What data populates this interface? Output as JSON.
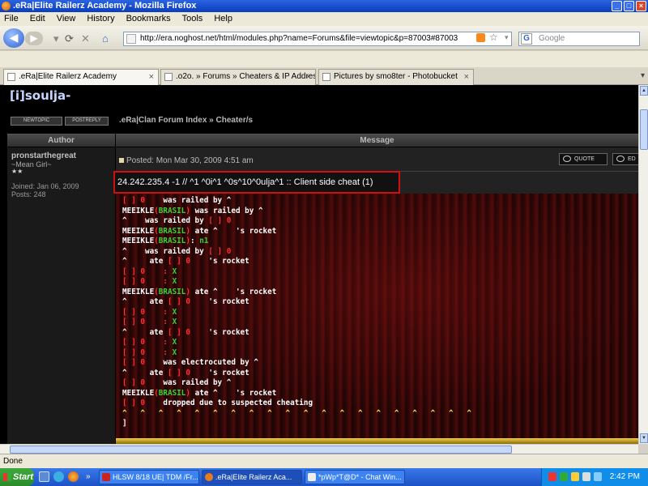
{
  "window": {
    "title": ".eRa|Elite Railerz Academy - Mozilla Firefox"
  },
  "menu": [
    "File",
    "Edit",
    "View",
    "History",
    "Bookmarks",
    "Tools",
    "Help"
  ],
  "nav": {
    "url": "http://era.noghost.net/html/modules.php?name=Forums&file=viewtopic&p=87003#87003",
    "search_placeholder": "Google"
  },
  "tabs": [
    {
      "label": ".eRa|Elite Railerz Academy",
      "active": true
    },
    {
      "label": ".o2o. » Forums » Cheaters & IP Addres...",
      "active": false
    },
    {
      "label": "Pictures by smo8ter - Photobucket",
      "active": false
    }
  ],
  "page": {
    "site_title": "[i]soulja-",
    "newtopic": "NEWTOPIC",
    "postreply": "POSTREPLY",
    "breadcrumb": ".eRa|Clan Forum Index » Cheater/s",
    "col_author": "Author",
    "col_message": "Message"
  },
  "post": {
    "author": "pronstarthegreat",
    "author_title": "~Mean Girl~",
    "rank": "★★",
    "joined": "Joined: Jan 06, 2009",
    "posts": "Posts: 248",
    "posted": "Posted: Mon Mar 30, 2009 4:51 am",
    "quote_btn": "QUOTE",
    "edit_btn": "ED",
    "headline": "24.242.235.4 -1 // ^1 ^0i^1 ^0s^10^0ulja^1 :: Client side cheat (1)"
  },
  "console_lines": [
    [
      {
        "t": "[ ] 0 ",
        "c": "r"
      },
      {
        "t": "   was railed by ^",
        "c": "w"
      }
    ],
    [
      {
        "t": "MEEIKLE",
        "c": "w"
      },
      {
        "t": "(",
        "c": "r"
      },
      {
        "t": "BRASIL",
        "c": "g"
      },
      {
        "t": ")",
        "c": "r"
      },
      {
        "t": " was railed by ^",
        "c": "w"
      }
    ],
    [
      {
        "t": "^    was railed by ",
        "c": "w"
      },
      {
        "t": "[ ] 0",
        "c": "r"
      }
    ],
    [
      {
        "t": "MEEIKLE",
        "c": "w"
      },
      {
        "t": "(",
        "c": "r"
      },
      {
        "t": "BRASIL",
        "c": "g"
      },
      {
        "t": ")",
        "c": "r"
      },
      {
        "t": " ate ^    's rocket",
        "c": "w"
      }
    ],
    [
      {
        "t": "MEEIKLE",
        "c": "w"
      },
      {
        "t": "(",
        "c": "r"
      },
      {
        "t": "BRASIL",
        "c": "g"
      },
      {
        "t": ")",
        "c": "r"
      },
      {
        "t": ": ",
        "c": "w"
      },
      {
        "t": "n1",
        "c": "g"
      }
    ],
    [
      {
        "t": "^    was railed by ",
        "c": "w"
      },
      {
        "t": "[ ] 0",
        "c": "r"
      }
    ],
    [
      {
        "t": "^     ate ",
        "c": "w"
      },
      {
        "t": "[ ] 0",
        "c": "r"
      },
      {
        "t": "    's rocket",
        "c": "w"
      }
    ],
    [
      {
        "t": "[ ] 0    : ",
        "c": "r"
      },
      {
        "t": "X",
        "c": "g"
      }
    ],
    [
      {
        "t": "[ ] 0    : ",
        "c": "r"
      },
      {
        "t": "X",
        "c": "g"
      }
    ],
    [
      {
        "t": "MEEIKLE",
        "c": "w"
      },
      {
        "t": "(",
        "c": "r"
      },
      {
        "t": "BRASIL",
        "c": "g"
      },
      {
        "t": ")",
        "c": "r"
      },
      {
        "t": " ate ^    's rocket",
        "c": "w"
      }
    ],
    [
      {
        "t": "^     ate ",
        "c": "w"
      },
      {
        "t": "[ ] 0",
        "c": "r"
      },
      {
        "t": "    's rocket",
        "c": "w"
      }
    ],
    [
      {
        "t": "[ ] 0    : ",
        "c": "r"
      },
      {
        "t": "X",
        "c": "g"
      }
    ],
    [
      {
        "t": "[ ] 0    : ",
        "c": "r"
      },
      {
        "t": "X",
        "c": "g"
      }
    ],
    [
      {
        "t": "^     ate ",
        "c": "w"
      },
      {
        "t": "[ ] 0",
        "c": "r"
      },
      {
        "t": "    's rocket",
        "c": "w"
      }
    ],
    [
      {
        "t": "[ ] 0    : ",
        "c": "r"
      },
      {
        "t": "X",
        "c": "g"
      }
    ],
    [
      {
        "t": "[ ] 0    : ",
        "c": "r"
      },
      {
        "t": "X",
        "c": "g"
      }
    ],
    [
      {
        "t": "[ ] 0 ",
        "c": "r"
      },
      {
        "t": "   was electrocuted by ^",
        "c": "w"
      }
    ],
    [
      {
        "t": "^     ate ",
        "c": "w"
      },
      {
        "t": "[ ] 0",
        "c": "r"
      },
      {
        "t": "    's rocket",
        "c": "w"
      }
    ],
    [
      {
        "t": "[ ] 0 ",
        "c": "r"
      },
      {
        "t": "   was railed by ^",
        "c": "w"
      }
    ],
    [
      {
        "t": "MEEIKLE",
        "c": "w"
      },
      {
        "t": "(",
        "c": "r"
      },
      {
        "t": "BRASIL",
        "c": "g"
      },
      {
        "t": ")",
        "c": "r"
      },
      {
        "t": " ate ^    's rocket",
        "c": "w"
      }
    ],
    [
      {
        "t": "[ ] 0 ",
        "c": "r"
      },
      {
        "t": "   dropped due to suspected cheating",
        "c": "w"
      }
    ],
    [
      {
        "t": "^   ^   ^   ^   ^   ^   ^   ^   ^   ^   ^   ^   ^   ^   ^   ^   ^   ^   ^   ^",
        "c": "y"
      }
    ],
    [
      {
        "t": "]",
        "c": "w"
      }
    ]
  ],
  "status": "Done",
  "taskbar": {
    "start": "Start",
    "items": [
      {
        "label": "HLSW   8/18 UE| TDM /Fr...",
        "active": false
      },
      {
        "label": ".eRa|Elite Railerz Aca...",
        "active": true
      },
      {
        "label": "*pWp*T@D* - Chat Win...",
        "active": false
      }
    ],
    "clock": "2:42 PM"
  },
  "colors": {
    "accent_red": "#d01010",
    "console_green": "#3ad13a",
    "console_red": "#ff3030"
  }
}
